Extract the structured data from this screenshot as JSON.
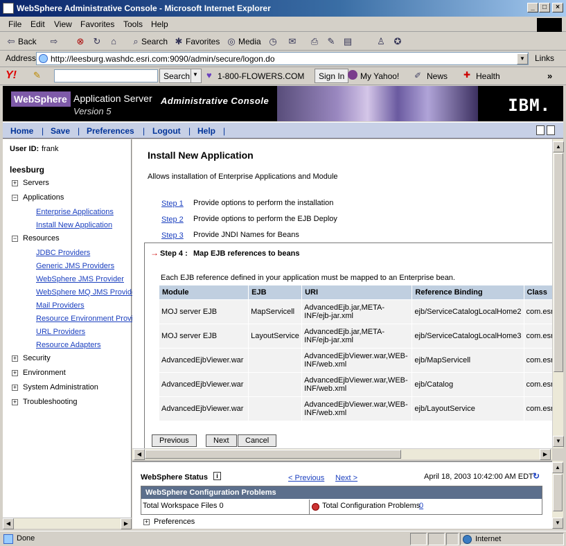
{
  "window": {
    "title": "WebSphere Administrative Console - Microsoft Internet Explorer",
    "min": "_",
    "max": "□",
    "close": "×"
  },
  "menu": [
    "File",
    "Edit",
    "View",
    "Favorites",
    "Tools",
    "Help"
  ],
  "toolbar": {
    "back": "Back",
    "search": "Search",
    "favorites": "Favorites",
    "media": "Media"
  },
  "address": {
    "label": "Address",
    "url": "http://leesburg.washdc.esri.com:9090/admin/secure/logon.do",
    "links": "Links"
  },
  "yahoo": {
    "logo": "Y!",
    "search_btn": "Search",
    "flowers": "1-800-FLOWERS.COM",
    "signin": "Sign In",
    "myyahoo": "My Yahoo!",
    "news": "News",
    "health": "Health",
    "more": "»"
  },
  "banner": {
    "logo": "WebSphere",
    "product": "Application Server",
    "version": "Version 5",
    "console": "Administrative Console",
    "ibm": "IBM."
  },
  "nav": {
    "home": "Home",
    "save": "Save",
    "preferences": "Preferences",
    "logout": "Logout",
    "help": "Help",
    "sep": "|"
  },
  "left": {
    "user_label": "User ID:",
    "user": "frank",
    "node": "leesburg",
    "servers": "Servers",
    "applications": "Applications",
    "enterprise_apps": "Enterprise Applications",
    "install_new": "Install New Application",
    "resources": "Resources",
    "jdbc": "JDBC Providers",
    "generic_jms": "Generic JMS Providers",
    "ws_jms": "WebSphere JMS Provider",
    "ws_mq": "WebSphere MQ JMS Provide",
    "mail": "Mail Providers",
    "res_env": "Resource Environment Provi",
    "url": "URL Providers",
    "adapters": "Resource Adapters",
    "security": "Security",
    "environment": "Environment",
    "sysadmin": "System Administration",
    "trouble": "Troubleshooting",
    "plus": "+",
    "minus": "−"
  },
  "main": {
    "title": "Install New Application",
    "desc": "Allows installation of Enterprise Applications and Module",
    "steps": [
      {
        "link": "Step 1",
        "text": "Provide options to perform the installation"
      },
      {
        "link": "Step 2",
        "text": "Provide options to perform the EJB Deploy"
      },
      {
        "link": "Step 3",
        "text": "Provide JNDI Names for Beans"
      }
    ],
    "step4_arrow": "→",
    "step4_label": "Step 4 :",
    "step4_title": "Map EJB references to beans",
    "step4_desc": "Each EJB reference defined in your application must be mapped to an Enterprise bean.",
    "columns": [
      "Module",
      "EJB",
      "URI",
      "Reference Binding",
      "Class"
    ],
    "rows": [
      [
        "MOJ server EJB",
        "MapServicell",
        "AdvancedEjb.jar,META-INF/ejb-jar.xml",
        "ejb/ServiceCatalogLocalHome2",
        "com.esri"
      ],
      [
        "MOJ server EJB",
        "LayoutService",
        "AdvancedEjb.jar,META-INF/ejb-jar.xml",
        "ejb/ServiceCatalogLocalHome3",
        "com.esri"
      ],
      [
        "AdvancedEjbViewer.war",
        "",
        "AdvancedEjbViewer.war,WEB-INF/web.xml",
        "ejb/MapServicell",
        "com.esri"
      ],
      [
        "AdvancedEjbViewer.war",
        "",
        "AdvancedEjbViewer.war,WEB-INF/web.xml",
        "ejb/Catalog",
        "com.esri"
      ],
      [
        "AdvancedEjbViewer.war",
        "",
        "AdvancedEjbViewer.war,WEB-INF/web.xml",
        "ejb/LayoutService",
        "com.esri"
      ]
    ],
    "previous": "Previous",
    "next": "Next",
    "cancel": "Cancel"
  },
  "status": {
    "title": "WebSphere Status",
    "info": "i",
    "prev": "< Previous",
    "next": "Next >",
    "date": "April 18, 2003 10:42:00 AM EDT",
    "config_header": "WebSphere Configuration Problems",
    "workspace": "Total Workspace Files 0",
    "problems_label": "Total Configuration Problems",
    "problems_count": "0",
    "preferences": "Preferences"
  },
  "statusbar": {
    "done": "Done",
    "zone": "Internet"
  }
}
